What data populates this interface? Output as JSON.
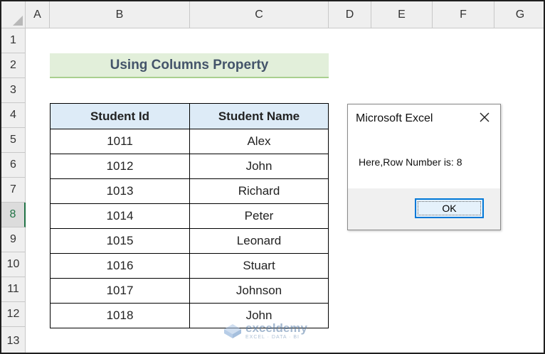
{
  "columns": [
    "A",
    "B",
    "C",
    "D",
    "E",
    "F",
    "G"
  ],
  "rows": [
    "1",
    "2",
    "3",
    "4",
    "5",
    "6",
    "7",
    "8",
    "9",
    "10",
    "11",
    "12",
    "13"
  ],
  "active_row": "8",
  "title": "Using Columns Property",
  "table": {
    "headers": [
      "Student Id",
      "Student Name"
    ],
    "rows": [
      [
        "1011",
        "Alex"
      ],
      [
        "1012",
        "John"
      ],
      [
        "1013",
        "Richard"
      ],
      [
        "1014",
        "Peter"
      ],
      [
        "1015",
        "Leonard"
      ],
      [
        "1016",
        "Stuart"
      ],
      [
        "1017",
        "Johnson"
      ],
      [
        "1018",
        "John"
      ]
    ]
  },
  "dialog": {
    "title": "Microsoft Excel",
    "message": "Here,Row Number is: 8",
    "ok_label": "OK",
    "close_icon": "close-icon"
  },
  "watermark": {
    "name": "exceldemy",
    "tagline": "EXCEL · DATA · BI"
  },
  "colors": {
    "title_fill": "#e2efda",
    "header_fill": "#ddebf7",
    "excel_green": "#217346",
    "ok_border": "#0078d7"
  }
}
